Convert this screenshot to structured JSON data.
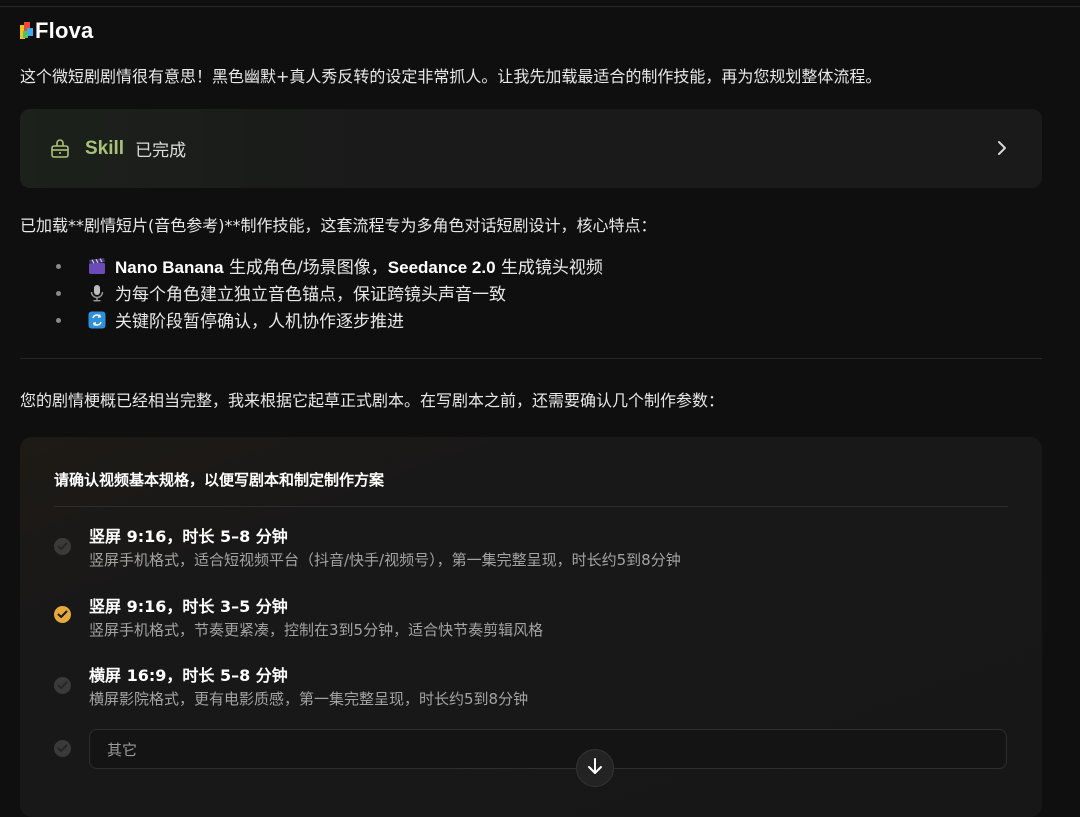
{
  "app": {
    "brand": "Flova"
  },
  "intro_text": "这个微短剧剧情很有意思！黑色幽默+真人秀反转的设定非常抓人。让我先加载最适合的制作技能，再为您规划整体流程。",
  "skill_card": {
    "name": "Skill",
    "status": "已完成",
    "icon": "skill-box-icon",
    "accent": "#a9c27a"
  },
  "loaded_text": "已加载**剧情短片(音色参考)**制作技能，这套流程专为多角色对话短剧设计，核心特点：",
  "features": [
    {
      "icon": "clapperboard-icon",
      "bold1": "Nano Banana",
      "text1": " 生成角色/场景图像，",
      "bold2": "Seedance 2.0",
      "text2": " 生成镜头视频"
    },
    {
      "icon": "microphone-icon",
      "text": "为每个角色建立独立音色锚点，保证跨镜头声音一致"
    },
    {
      "icon": "repeat-icon",
      "text": "关键阶段暂停确认，人机协作逐步推进"
    }
  ],
  "para2": "您的剧情梗概已经相当完整，我来根据它起草正式剧本。在写剧本之前，还需要确认几个制作参数：",
  "form": {
    "title": "请确认视频基本规格，以便写剧本和制定制作方案",
    "options": [
      {
        "title": "竖屏 9:16，时长 5–8 分钟",
        "desc": "竖屏手机格式，适合短视频平台（抖音/快手/视频号），第一集完整呈现，时长约5到8分钟",
        "selected": false
      },
      {
        "title": "竖屏 9:16，时长 3–5 分钟",
        "desc": "竖屏手机格式，节奏更紧凑，控制在3到5分钟，适合快节奏剪辑风格",
        "selected": true
      },
      {
        "title": "横屏 16:9，时长 5–8 分钟",
        "desc": "横屏影院格式，更有电影质感，第一集完整呈现，时长约5到8分钟",
        "selected": false
      }
    ],
    "other_placeholder": "其它",
    "selected_color": "#e6a93c"
  }
}
